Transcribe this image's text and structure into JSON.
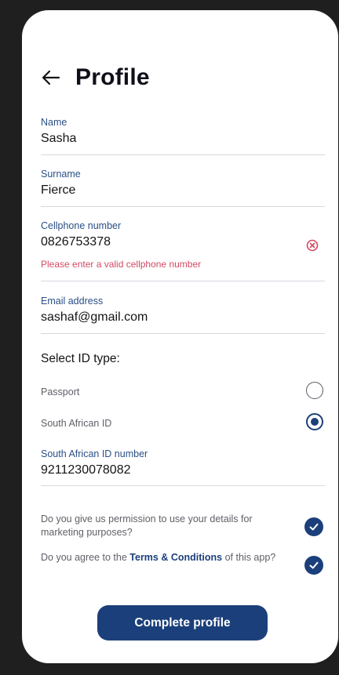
{
  "header": {
    "title": "Profile"
  },
  "form": {
    "name": {
      "label": "Name",
      "value": "Sasha"
    },
    "surname": {
      "label": "Surname",
      "value": "Fierce"
    },
    "cellphone": {
      "label": "Cellphone number",
      "value": "0826753378",
      "error": "Please enter a valid cellphone number"
    },
    "email": {
      "label": "Email address",
      "value": "sashaf@gmail.com"
    },
    "id_type": {
      "title": "Select ID type:",
      "options": [
        {
          "label": "Passport",
          "selected": false
        },
        {
          "label": "South African ID",
          "selected": true
        }
      ]
    },
    "id_number": {
      "label": "South African ID number",
      "value": "9211230078082"
    }
  },
  "consents": {
    "marketing": {
      "text": "Do you give us permission to use your details for marketing purposes?",
      "checked": true
    },
    "terms": {
      "text_before": "Do you agree to the ",
      "link": "Terms & Conditions",
      "text_after": " of this app?",
      "checked": true
    }
  },
  "actions": {
    "complete_label": "Complete profile"
  },
  "colors": {
    "primary": "#1b3f7a",
    "label": "#2a4f86",
    "error": "#d24a63",
    "divider": "#d6d9df"
  },
  "icons": {
    "back": "arrow-left-icon",
    "error": "error-circle-icon",
    "check": "checkmark-icon"
  }
}
